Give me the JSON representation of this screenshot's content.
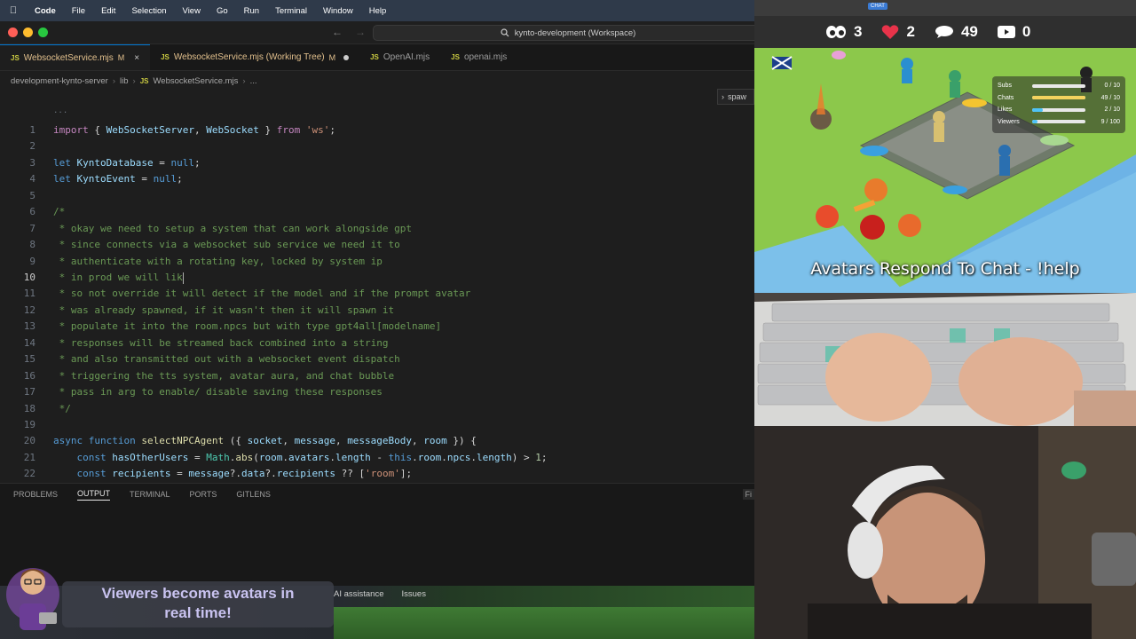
{
  "menubar": {
    "app": "Code",
    "items": [
      "File",
      "Edit",
      "Selection",
      "View",
      "Go",
      "Run",
      "Terminal",
      "Window",
      "Help"
    ]
  },
  "titlebar": {
    "search": "kynto-development (Workspace)"
  },
  "tabs": [
    {
      "label": "WebsocketService.mjs",
      "badge": "M",
      "active": true
    },
    {
      "label": "WebsocketService.mjs (Working Tree)",
      "badge": "M",
      "active": false
    },
    {
      "label": "OpenAI.mjs",
      "badge": "",
      "active": false
    },
    {
      "label": "openai.mjs",
      "badge": "",
      "active": false
    }
  ],
  "breadcrumb": [
    "development-kynto-server",
    "lib",
    "WebsocketService.mjs",
    "..."
  ],
  "editor": {
    "fold_hint": "...",
    "spawn_hint": "spaw",
    "line_numbers": [
      "1",
      "2",
      "3",
      "4",
      "5",
      "6",
      "7",
      "8",
      "9",
      "10",
      "11",
      "12",
      "13",
      "14",
      "15",
      "16",
      "17",
      "18",
      "19",
      "20",
      "21",
      "22"
    ]
  },
  "panel": {
    "tabs": [
      "PROBLEMS",
      "OUTPUT",
      "TERMINAL",
      "PORTS",
      "GITLENS"
    ],
    "active": "OUTPUT",
    "right_label": "Fi"
  },
  "status_overlay": {
    "items": [
      "AI assistance",
      "Issues"
    ],
    "banner_line1": "Viewers become avatars in",
    "banner_line2": "real time!"
  },
  "stream": {
    "stats": {
      "viewers": "3",
      "hearts": "2",
      "chats": "49",
      "videos": "0"
    },
    "progress": [
      {
        "label": "Subs",
        "value": "0 / 10",
        "fraction": 0.0,
        "color": "#f4d35e"
      },
      {
        "label": "Chats",
        "value": "49 / 10",
        "fraction": 1.0,
        "color": "#f4d35e"
      },
      {
        "label": "Likes",
        "value": "2 / 10",
        "fraction": 0.2,
        "color": "#4fc3f7"
      },
      {
        "label": "Viewers",
        "value": "9 / 100",
        "fraction": 0.09,
        "color": "#4fc3f7"
      }
    ],
    "caption": "Avatars Respond To Chat - !help",
    "chat_badge": "CHAT"
  }
}
